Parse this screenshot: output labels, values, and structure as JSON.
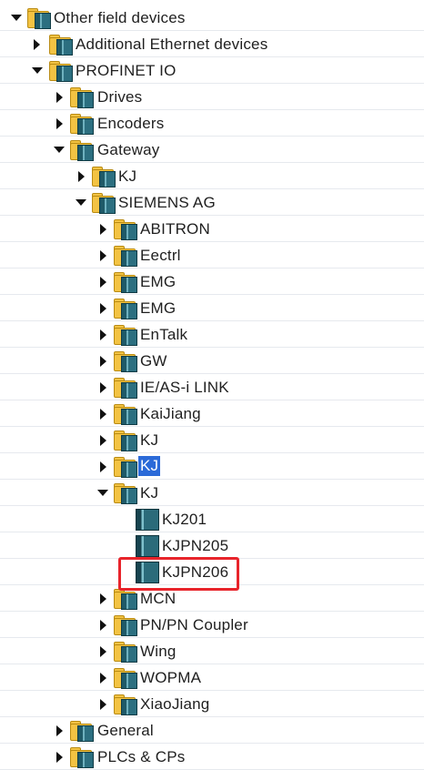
{
  "tree": {
    "other_field_devices": "Other field devices",
    "additional_ethernet_devices": "Additional Ethernet devices",
    "profinet_io": "PROFINET IO",
    "drives": "Drives",
    "encoders": "Encoders",
    "gateway": "Gateway",
    "gateway_kj": "KJ",
    "siemens_ag": "SIEMENS AG",
    "abitron": "ABITRON",
    "eectrl": "Eectrl",
    "emg1": "EMG",
    "emg2": "EMG",
    "entalk": "EnTalk",
    "gw": "GW",
    "ie_asi_link": "IE/AS-i LINK",
    "kaijiang": "KaiJiang",
    "kj1": "KJ",
    "kj2": "KJ",
    "kj3": "KJ",
    "kj201": "KJ201",
    "kjpn205": "KJPN205",
    "kjpn206": "KJPN206",
    "mcn": "MCN",
    "pn_pn_coupler": "PN/PN Coupler",
    "wing": "Wing",
    "wopma": "WOPMA",
    "xiaojiang": "XiaoJiang",
    "general": "General",
    "plcs_cps": "PLCs & CPs"
  },
  "colors": {
    "selection": "#2b6ad8",
    "highlight_box": "#e8242b",
    "folder": "#f3c343"
  }
}
